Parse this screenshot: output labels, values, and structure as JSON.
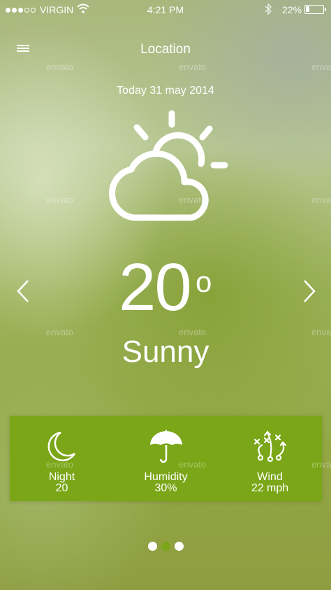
{
  "status_bar": {
    "carrier": "VIRGIN",
    "signal_bars_filled": 3,
    "signal_bars_total": 5,
    "time": "4:21 PM",
    "battery_percent": "22%",
    "battery_level": 0.22
  },
  "header": {
    "title": "Location",
    "menu_icon": "hamburger-menu-icon"
  },
  "weather": {
    "date": "Today 31 may 2014",
    "icon": "sun-behind-cloud-icon",
    "temperature": "20",
    "degree_symbol": "o",
    "condition": "Sunny"
  },
  "navigation": {
    "prev_icon": "chevron-left-icon",
    "next_icon": "chevron-right-icon"
  },
  "stats": [
    {
      "icon": "moon-icon",
      "label": "Night",
      "value": "20"
    },
    {
      "icon": "umbrella-icon",
      "label": "Humidity",
      "value": "30%"
    },
    {
      "icon": "wind-strategy-icon",
      "label": "Wind",
      "value": "22 mph"
    }
  ],
  "pager": {
    "count": 3,
    "active_index": 1
  },
  "watermark": "envato",
  "colors": {
    "accent": "#7aa617",
    "text": "#ffffff"
  }
}
